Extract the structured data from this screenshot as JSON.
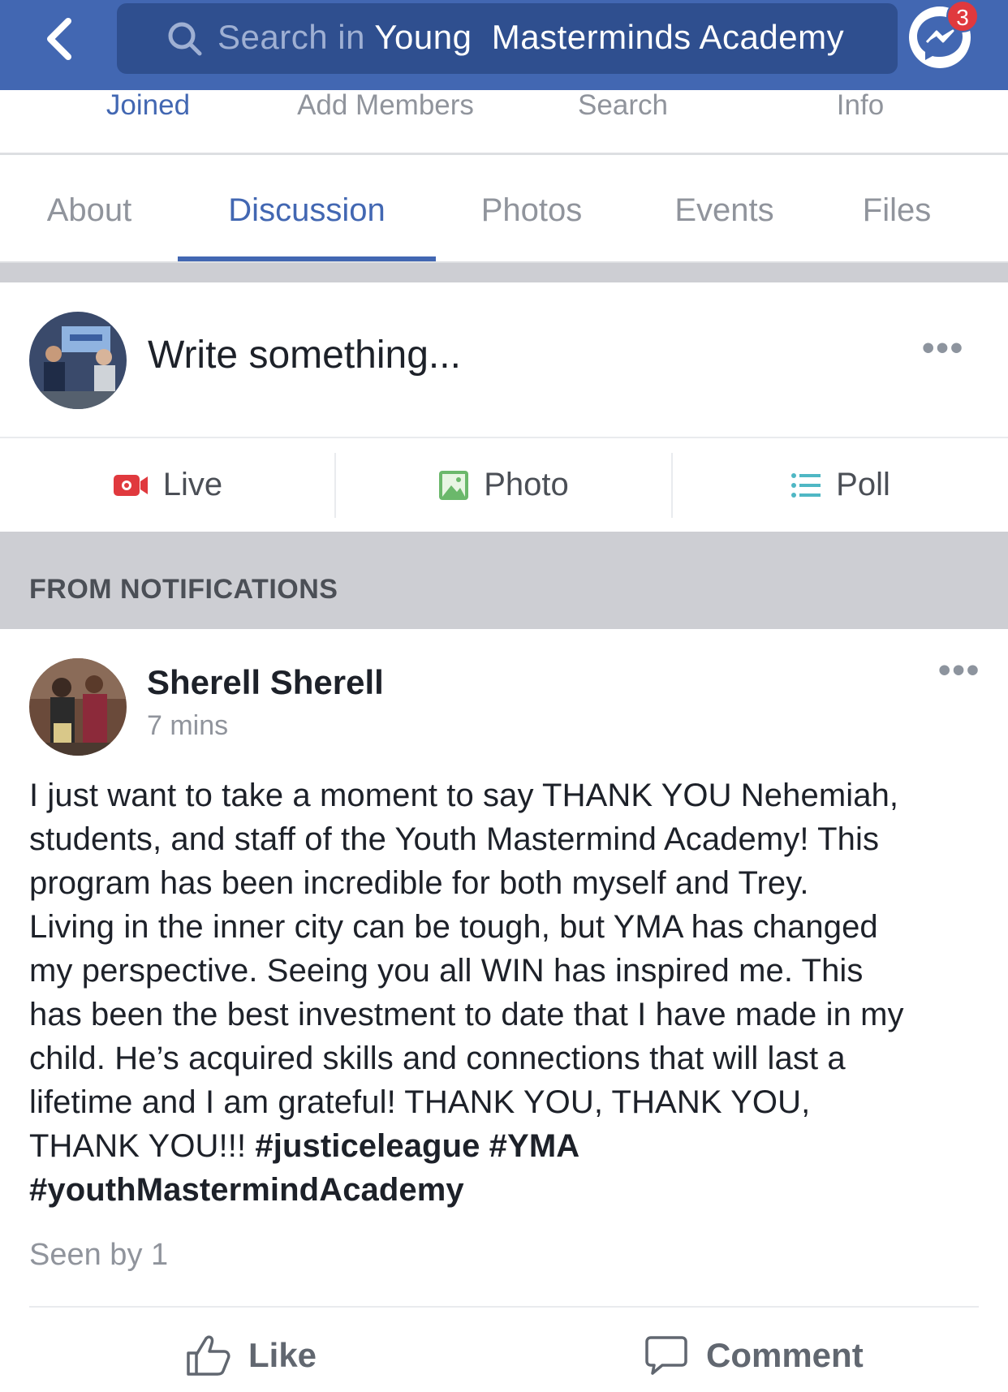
{
  "header": {
    "search_prefix": "Search in",
    "search_query": "Young  Masterminds Academy",
    "badge_count": "3",
    "bar_color": "#4267b2"
  },
  "subnav": {
    "items": [
      {
        "label": "Joined",
        "active": true
      },
      {
        "label": "Add Members",
        "active": false
      },
      {
        "label": "Search",
        "active": false
      },
      {
        "label": "Info",
        "active": false
      }
    ]
  },
  "tabs": {
    "items": [
      {
        "label": "About",
        "active": false
      },
      {
        "label": "Discussion",
        "active": true
      },
      {
        "label": "Photos",
        "active": false
      },
      {
        "label": "Events",
        "active": false
      },
      {
        "label": "Files",
        "active": false
      }
    ]
  },
  "composer": {
    "placeholder": "Write something...",
    "more": "•••",
    "actions": [
      {
        "label": "Live",
        "icon": "live-video-icon"
      },
      {
        "label": "Photo",
        "icon": "photo-icon"
      },
      {
        "label": "Poll",
        "icon": "poll-list-icon"
      }
    ]
  },
  "section_header": "FROM NOTIFICATIONS",
  "post": {
    "author": "Sherell Sherell",
    "time": "7 mins",
    "more": "•••",
    "body_lines": [
      "I just want to take a moment to say THANK YOU Nehemiah,",
      "students, and staff of the Youth Mastermind Academy! This",
      "program has been incredible for both myself and Trey.",
      "Living in the inner city can be tough, but YMA has changed",
      "my perspective. Seeing you all WIN has inspired me. This",
      "has been the best investment to date that I have made in my",
      "child. He’s acquired skills and connections that will last a",
      "lifetime and I am grateful! THANK YOU, THANK YOU,"
    ],
    "body_last_line_text": "THANK YOU!!! ",
    "hashtags_line1": "#justiceleague #YMA",
    "hashtags_line2": "#youthMastermindAcademy",
    "seen_by": "Seen by 1",
    "like_label": "Like",
    "comment_label": "Comment"
  }
}
